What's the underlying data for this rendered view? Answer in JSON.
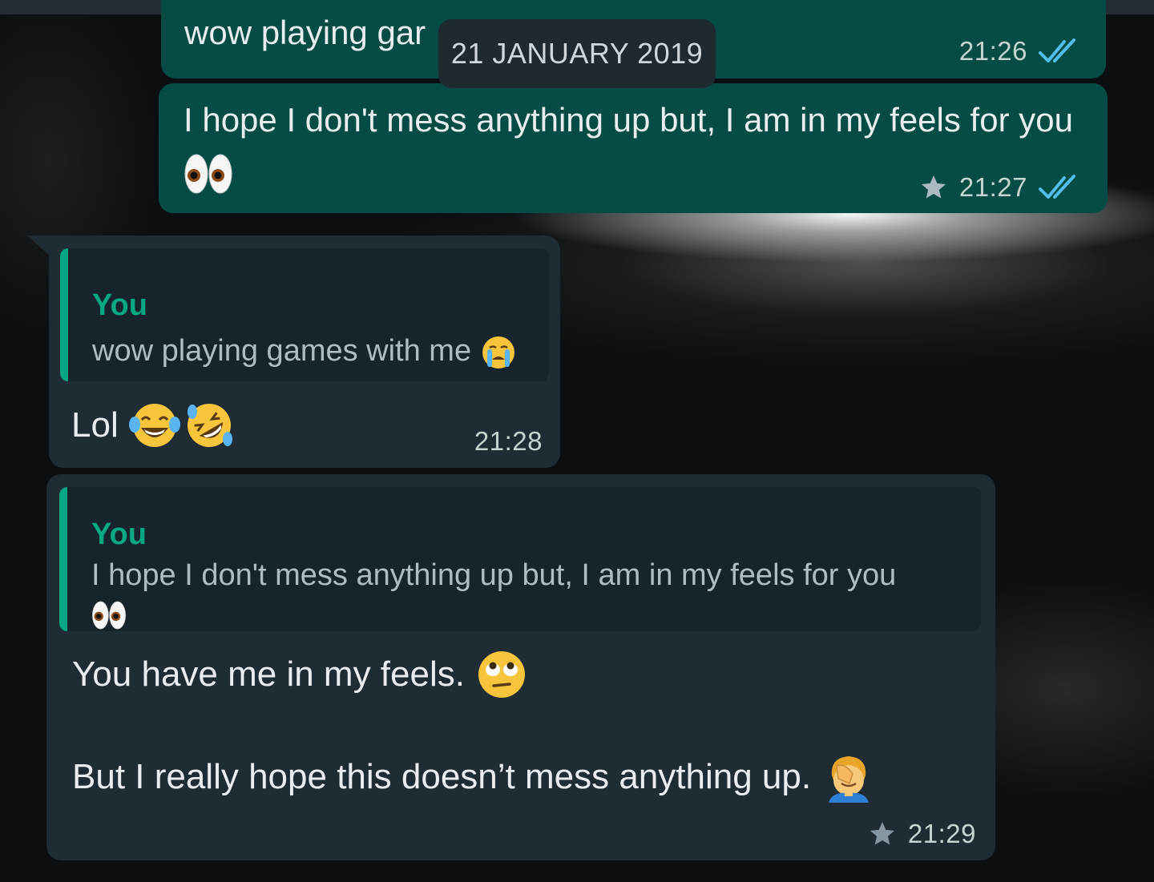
{
  "status_bar": {},
  "date_separator": "21 JANUARY 2019",
  "messages": [
    {
      "direction": "outgoing",
      "text": "wow playing gar",
      "time": "21:26",
      "status": "read",
      "starred": false
    },
    {
      "direction": "outgoing",
      "text": "I hope I don't mess anything up but, I am in my feels for you",
      "emoji": "eyes-emoji",
      "time": "21:27",
      "status": "read",
      "starred": true
    },
    {
      "direction": "incoming",
      "quote": {
        "author": "You",
        "text": "wow playing games with me",
        "emoji": "crying-face-emoji"
      },
      "text": "Lol",
      "emojis": [
        "tears-of-joy-emoji",
        "rolling-laughing-emoji"
      ],
      "time": "21:28",
      "starred": false
    },
    {
      "direction": "incoming",
      "quote": {
        "author": "You",
        "text": "I hope I don't mess anything up but, I am in my feels for you",
        "emoji": "eyes-emoji"
      },
      "line1": "You have me in my feels.",
      "line1_emoji": "eye-roll-emoji",
      "line2": "But I really hope this doesn’t mess anything up.",
      "line2_emoji": "facepalm-emoji",
      "time": "21:29",
      "starred": true
    }
  ],
  "colors": {
    "outgoing_bubble": "#054d44",
    "incoming_bubble": "#1f2c34",
    "quote_accent": "#06a884",
    "read_ticks": "#53bdeb",
    "background": "#0b0f11"
  }
}
